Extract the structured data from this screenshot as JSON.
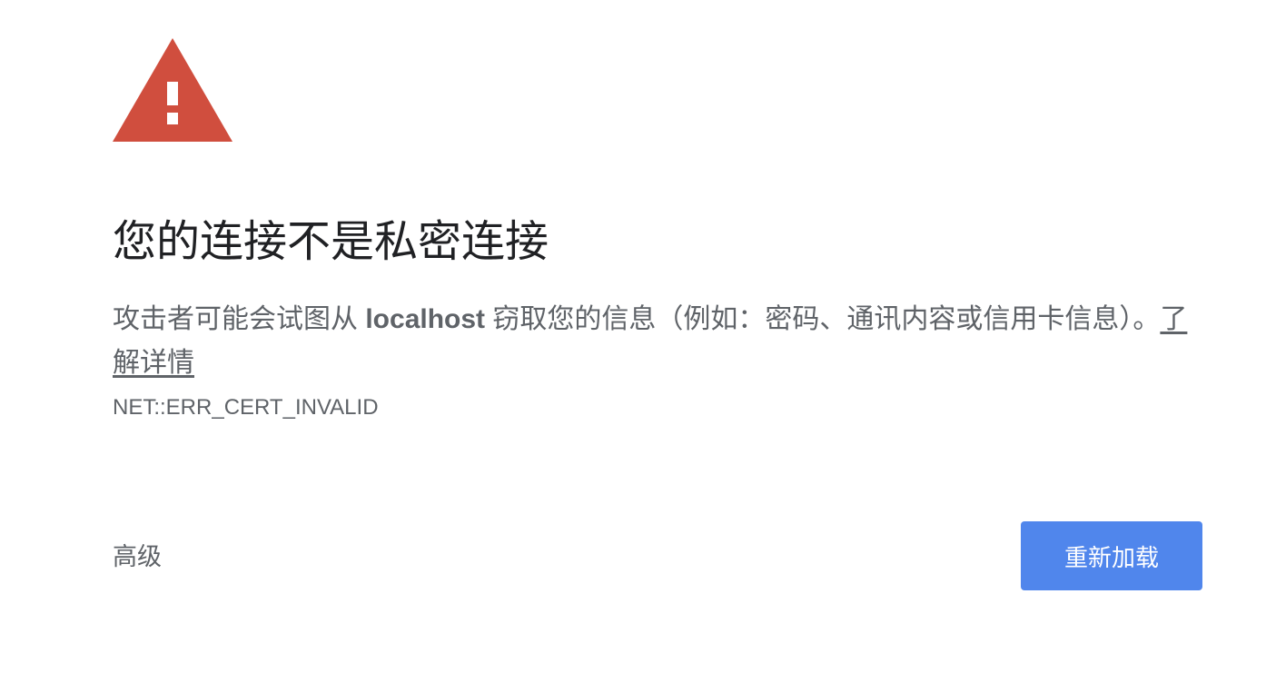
{
  "icon": {
    "name": "warning-triangle-icon",
    "color": "#d04e3e"
  },
  "title": "您的连接不是私密连接",
  "message": {
    "prefix": "攻击者可能会试图从 ",
    "host": "localhost",
    "suffix": " 窃取您的信息（例如：密码、通讯内容或信用卡信息）。",
    "learn_more": "了解详情"
  },
  "error_code": "NET::ERR_CERT_INVALID",
  "buttons": {
    "advanced": "高级",
    "reload": "重新加载"
  },
  "colors": {
    "primary_button": "#5086ec",
    "title_text": "#202124",
    "body_text": "#5f6368"
  }
}
